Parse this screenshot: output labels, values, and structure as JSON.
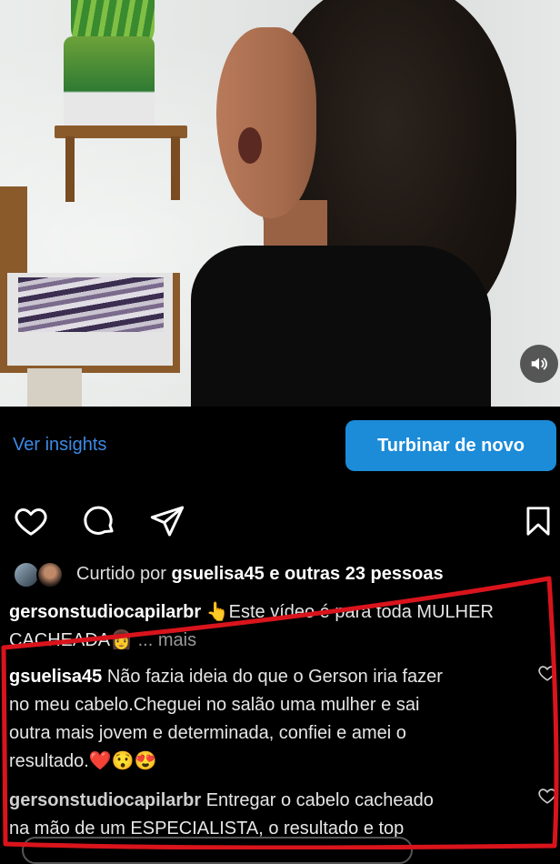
{
  "post": {
    "insights_label": "Ver insights",
    "boost_label": "Turbinar de novo"
  },
  "likes": {
    "prefix": "Curtido por",
    "user": "gsuelisa45",
    "connector": "e",
    "others": "outras 23 pessoas"
  },
  "caption": {
    "username": "gersonstudiocapilarbr",
    "text_1": "👆Este vídeo é para toda MULHER",
    "text_2": "CACHEADA",
    "emoji": "👩",
    "more": "... mais"
  },
  "comments": [
    {
      "username": "gsuelisa45",
      "lines": [
        "Não fazia ideia do que o Gerson iria fazer",
        "no meu cabelo.Cheguei no salão uma mulher e sai",
        "outra  mais jovem e determinada, confiei e amei o",
        "resultado."
      ],
      "emojis": "❤️😯😍"
    },
    {
      "username": "gersonstudiocapilarbr",
      "lines": [
        "Entregar o cabelo cacheado",
        "na mão de um ESPECIALISTA, o resultado e top"
      ]
    }
  ],
  "icons": {
    "like": "heart-icon",
    "comment": "comment-icon",
    "share": "send-icon",
    "save": "bookmark-icon",
    "sound": "speaker-icon"
  },
  "colors": {
    "link": "#3d8ae6",
    "button": "#1c8bd8",
    "annotation": "#d9141c"
  }
}
